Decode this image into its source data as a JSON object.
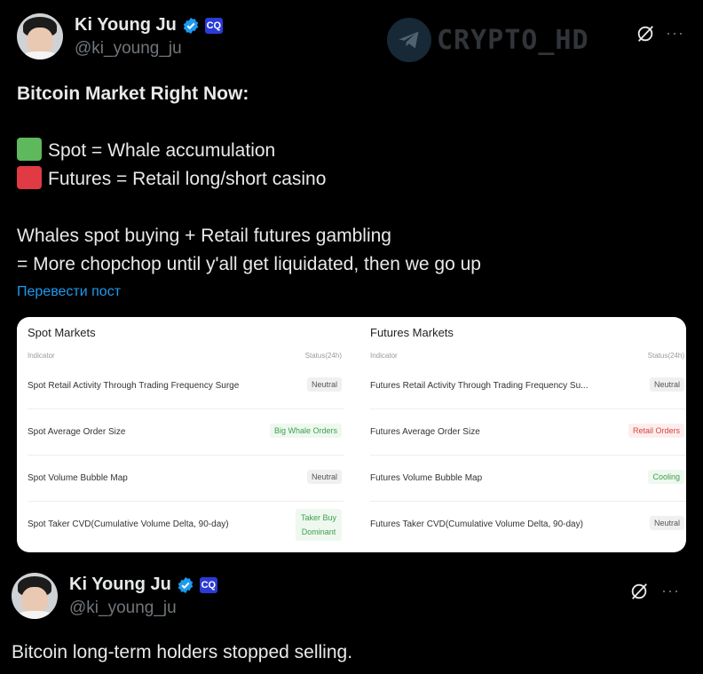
{
  "post1": {
    "author_name": "Ki Young Ju",
    "handle": "@ki_young_ju",
    "headline": "Bitcoin Market Right Now:",
    "spot_line": "Spot = Whale accumulation",
    "futures_line": "Futures = Retail long/short casino",
    "line3": "Whales spot buying + Retail futures gambling",
    "line4": "= More chopchop until y'all get liquidated, then we go up",
    "translate_link": "Перевести пост",
    "colors": {
      "spot_square": "#5eb85c",
      "futures_square": "#e03a45"
    }
  },
  "watermark": {
    "text": "CRYPTO_HD"
  },
  "card": {
    "spot": {
      "title": "Spot Markets",
      "col_indicator": "Indicator",
      "col_status": "Status(24h)",
      "rows": [
        {
          "label": "Spot Retail Activity Through Trading Frequency Surge",
          "status": "Neutral"
        },
        {
          "label": "Spot Average Order Size",
          "status": "Big Whale Orders"
        },
        {
          "label": "Spot Volume Bubble Map",
          "status": "Neutral"
        },
        {
          "label": "Spot Taker CVD(Cumulative Volume Delta, 90-day)",
          "status_line1": "Taker Buy",
          "status_line2": "Dominant"
        }
      ]
    },
    "futures": {
      "title": "Futures Markets",
      "col_indicator": "Indicator",
      "col_status": "Status(24h)",
      "rows": [
        {
          "label": "Futures Retail Activity Through Trading Frequency Su...",
          "status": "Neutral"
        },
        {
          "label": "Futures Average Order Size",
          "status": "Retail Orders"
        },
        {
          "label": "Futures Volume Bubble Map",
          "status": "Cooling"
        },
        {
          "label": "Futures Taker CVD(Cumulative Volume Delta, 90-day)",
          "status": "Neutral"
        }
      ]
    }
  },
  "post2": {
    "author_name": "Ki Young Ju",
    "handle": "@ki_young_ju",
    "text": "Bitcoin long-term holders stopped selling."
  },
  "icons": {
    "more": "···",
    "affiliate": "CQ"
  }
}
